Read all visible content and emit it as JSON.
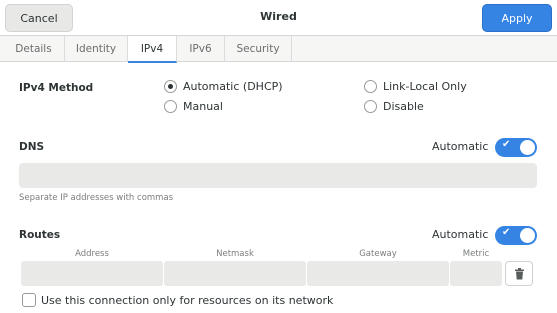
{
  "header": {
    "cancel_label": "Cancel",
    "title": "Wired",
    "apply_label": "Apply"
  },
  "tabs": [
    {
      "label": "Details",
      "active": false
    },
    {
      "label": "Identity",
      "active": false
    },
    {
      "label": "IPv4",
      "active": true
    },
    {
      "label": "IPv6",
      "active": false
    },
    {
      "label": "Security",
      "active": false
    }
  ],
  "ipv4_method": {
    "label": "IPv4 Method",
    "options": [
      {
        "label": "Automatic (DHCP)",
        "selected": true
      },
      {
        "label": "Link-Local Only",
        "selected": false
      },
      {
        "label": "Manual",
        "selected": false
      },
      {
        "label": "Disable",
        "selected": false
      }
    ]
  },
  "dns": {
    "label": "DNS",
    "automatic_label": "Automatic",
    "automatic_on": true,
    "value": "",
    "hint": "Separate IP addresses with commas"
  },
  "routes": {
    "label": "Routes",
    "automatic_label": "Automatic",
    "automatic_on": true,
    "columns": [
      "Address",
      "Netmask",
      "Gateway",
      "Metric"
    ]
  },
  "restrict_checkbox": {
    "label": "Use this connection only for resources on its network",
    "checked": false
  },
  "colors": {
    "accent": "#3584e4",
    "entry_bg": "#e9e9e8"
  }
}
